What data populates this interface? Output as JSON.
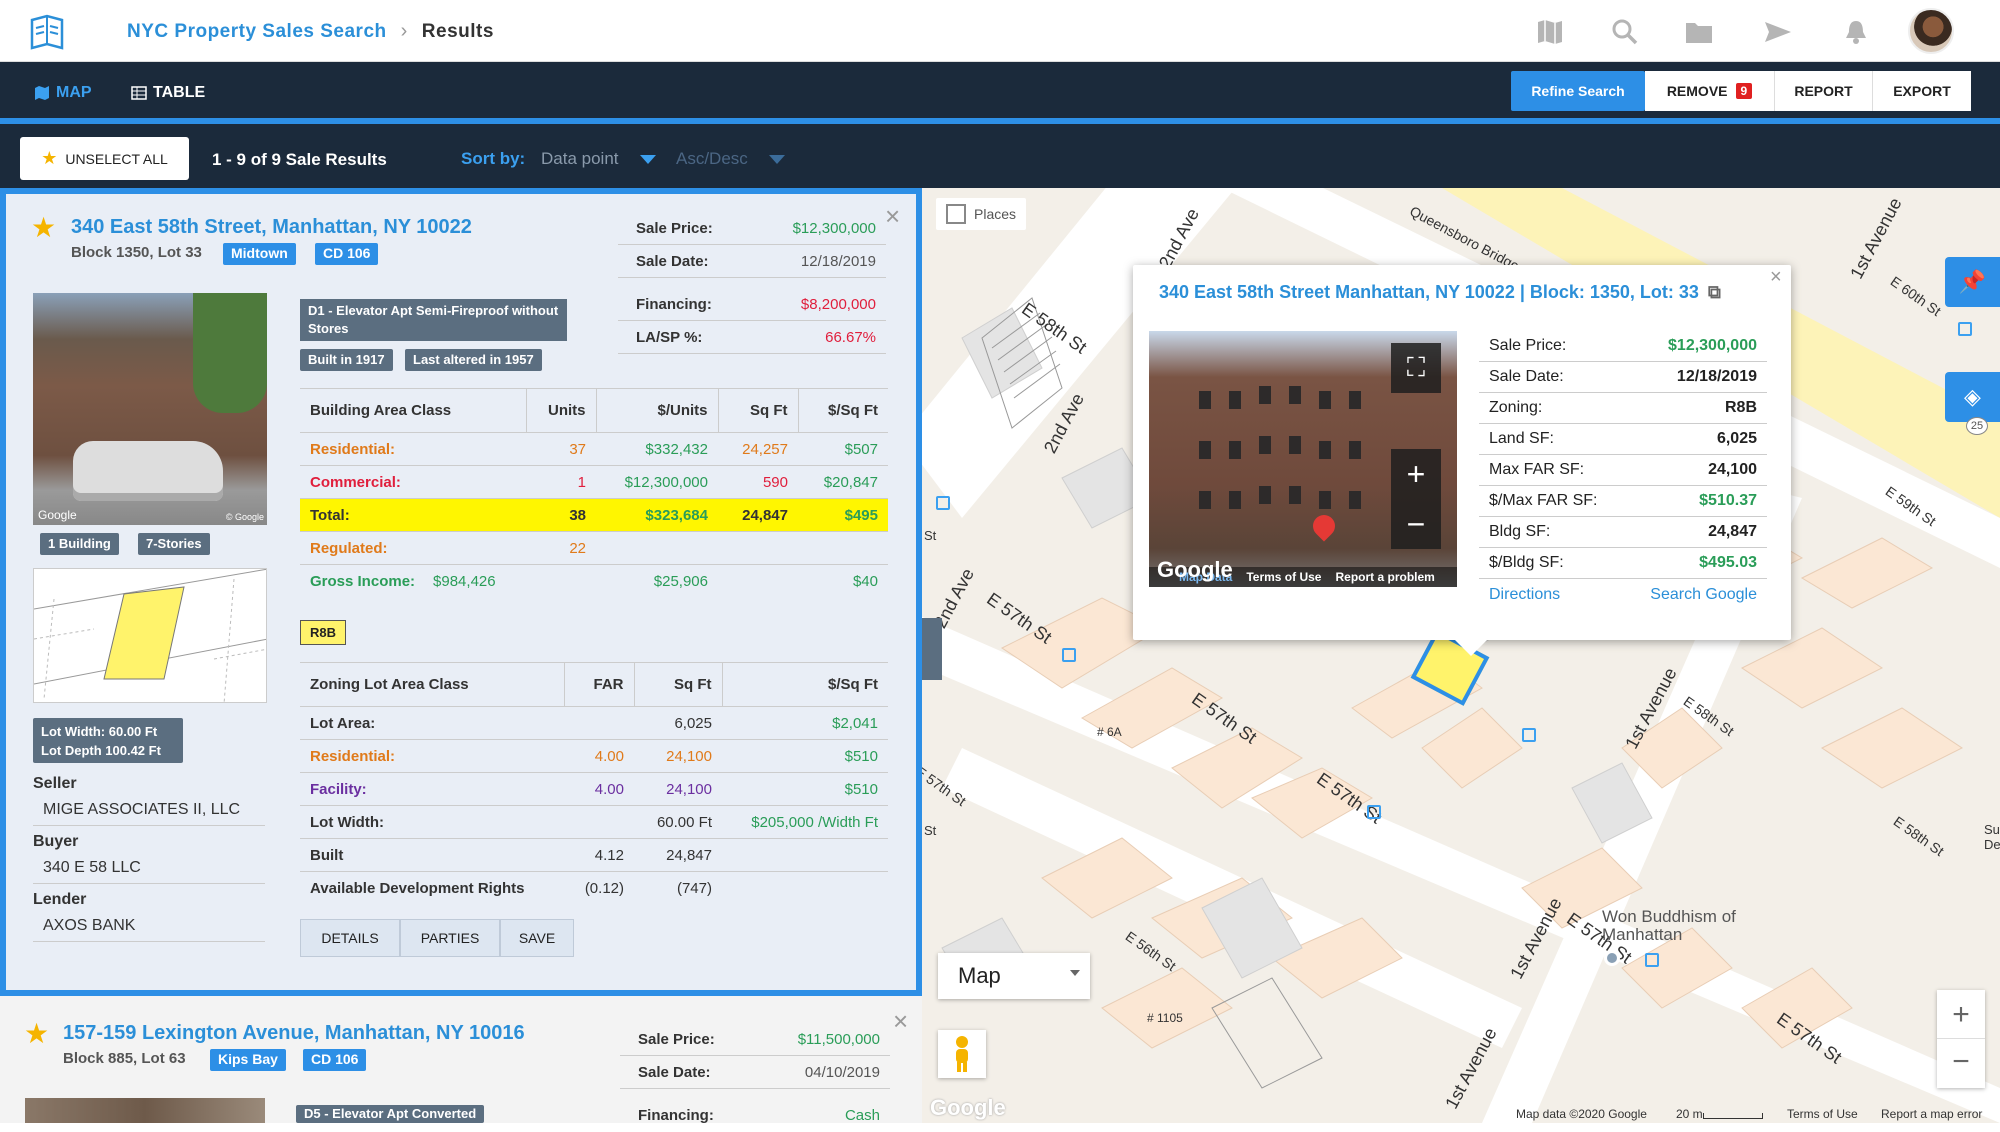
{
  "header": {
    "breadcrumb_link": "NYC Property Sales Search",
    "breadcrumb_current": "Results"
  },
  "nav": {
    "map_label": "MAP",
    "table_label": "TABLE",
    "refine_label": "Refine Search",
    "remove_label": "REMOVE",
    "remove_count": "9",
    "report_label": "REPORT",
    "export_label": "EXPORT"
  },
  "sortbar": {
    "unselect_label": "UNSELECT ALL",
    "results_text": "1 - 9 of 9 Sale Results",
    "sort_label": "Sort by:",
    "sort_value": "Data point",
    "order_value": "Asc/Desc"
  },
  "card1": {
    "address": "340 East 58th Street, Manhattan, NY 10022",
    "block_lot": "Block 1350, Lot 33",
    "tags": [
      "Midtown",
      "CD 106"
    ],
    "photo_credit": "Google",
    "photo_credit_small": "© Google",
    "building_tags": [
      "1 Building",
      "7-Stories"
    ],
    "lot_width": "Lot Width: 60.00 Ft",
    "lot_depth": "Lot Depth 100.42 Ft",
    "seller_label": "Seller",
    "seller": "MIGE ASSOCIATES II, LLC",
    "buyer_label": "Buyer",
    "buyer": "340 E 58 LLC",
    "lender_label": "Lender",
    "lender": "AXOS BANK",
    "sale": [
      {
        "label": "Sale Price:",
        "value": "$12,300,000"
      },
      {
        "label": "Sale Date:",
        "value": "12/18/2019"
      },
      {
        "label": "Financing:",
        "value": "$8,200,000"
      },
      {
        "label": "LA/SP %:",
        "value": "66.67%"
      }
    ],
    "class_desc": "D1 - Elevator Apt Semi-Fireproof without Stores",
    "built": "Built in 1917",
    "altered": "Last altered in 1957",
    "bldg_headers": [
      "Building Area Class",
      "Units",
      "$/Units",
      "Sq Ft",
      "$/Sq Ft"
    ],
    "bldg_rows": [
      [
        "Residential:",
        "37",
        "$332,432",
        "24,257",
        "$507"
      ],
      [
        "Commercial:",
        "1",
        "$12,300,000",
        "590",
        "$20,847"
      ],
      [
        "Total:",
        "38",
        "$323,684",
        "24,847",
        "$495"
      ],
      [
        "Regulated:",
        "22",
        "",
        "",
        ""
      ],
      [
        "Gross Income:",
        "$984,426",
        "$25,906",
        "",
        "$40"
      ]
    ],
    "zoning": "R8B",
    "zone_headers": [
      "Zoning Lot Area Class",
      "FAR",
      "Sq Ft",
      "$/Sq Ft"
    ],
    "zone_rows": [
      [
        "Lot Area:",
        "",
        "6,025",
        "$2,041"
      ],
      [
        "Residential:",
        "4.00",
        "24,100",
        "$510"
      ],
      [
        "Facility:",
        "4.00",
        "24,100",
        "$510"
      ],
      [
        "Lot Width:",
        "",
        "60.00 Ft",
        "$205,000 /Width Ft"
      ],
      [
        "Built",
        "4.12",
        "24,847",
        ""
      ],
      [
        "Available Development Rights",
        "(0.12)",
        "(747)",
        ""
      ]
    ],
    "actions": [
      "DETAILS",
      "PARTIES",
      "SAVE"
    ]
  },
  "card2": {
    "address": "157-159 Lexington Avenue, Manhattan, NY 10016",
    "block_lot": "Block 885, Lot 63",
    "tags": [
      "Kips Bay",
      "CD 106"
    ],
    "class_desc": "D5 - Elevator Apt Converted",
    "sale": [
      {
        "label": "Sale Price:",
        "value": "$11,500,000"
      },
      {
        "label": "Sale Date:",
        "value": "04/10/2019"
      },
      {
        "label": "Financing:",
        "value": "Cash"
      }
    ]
  },
  "map": {
    "places_label": "Places",
    "type_select": "Map",
    "footer": [
      "Map data ©2020 Google",
      "20 m",
      "Terms of Use",
      "Report a map error"
    ],
    "google_watermark": "Google",
    "layer_count": "25",
    "streets": [
      "2nd Ave",
      "E 58th St",
      "2nd Ave",
      "Queensboro Bridge Path",
      "1st Avenue",
      "E 60th St",
      "E 59th St",
      "E 57th St",
      "E 57th St",
      "E 57th St",
      "1st Avenue",
      "E 58th St",
      "E 58th St",
      "E 57th St",
      "1st Avenue",
      "E 56th St",
      "E 57th St",
      "1st Avenue",
      "E 57th St",
      "2nd Ave",
      "# 6A",
      "# 1105",
      "Won Buddhism of Manhattan",
      "St",
      "St",
      "Su De"
    ],
    "popup": {
      "title": "340 East 58th Street Manhattan, NY 10022 | Block: 1350, Lot: 33",
      "photo_footer": [
        "Google",
        "Map Data",
        "Terms of Use",
        "Report a problem"
      ],
      "rows": [
        {
          "label": "Sale Price:",
          "value": "$12,300,000"
        },
        {
          "label": "Sale Date:",
          "value": "12/18/2019"
        },
        {
          "label": "Zoning:",
          "value": "R8B"
        },
        {
          "label": "Land SF:",
          "value": "6,025"
        },
        {
          "label": "Max FAR SF:",
          "value": "24,100"
        },
        {
          "label": "$/Max FAR SF:",
          "value": "$510.37"
        },
        {
          "label": "Bldg SF:",
          "value": "24,847"
        },
        {
          "label": "$/Bldg SF:",
          "value": "$495.03"
        }
      ],
      "directions": "Directions",
      "search_google": "Search Google"
    }
  }
}
